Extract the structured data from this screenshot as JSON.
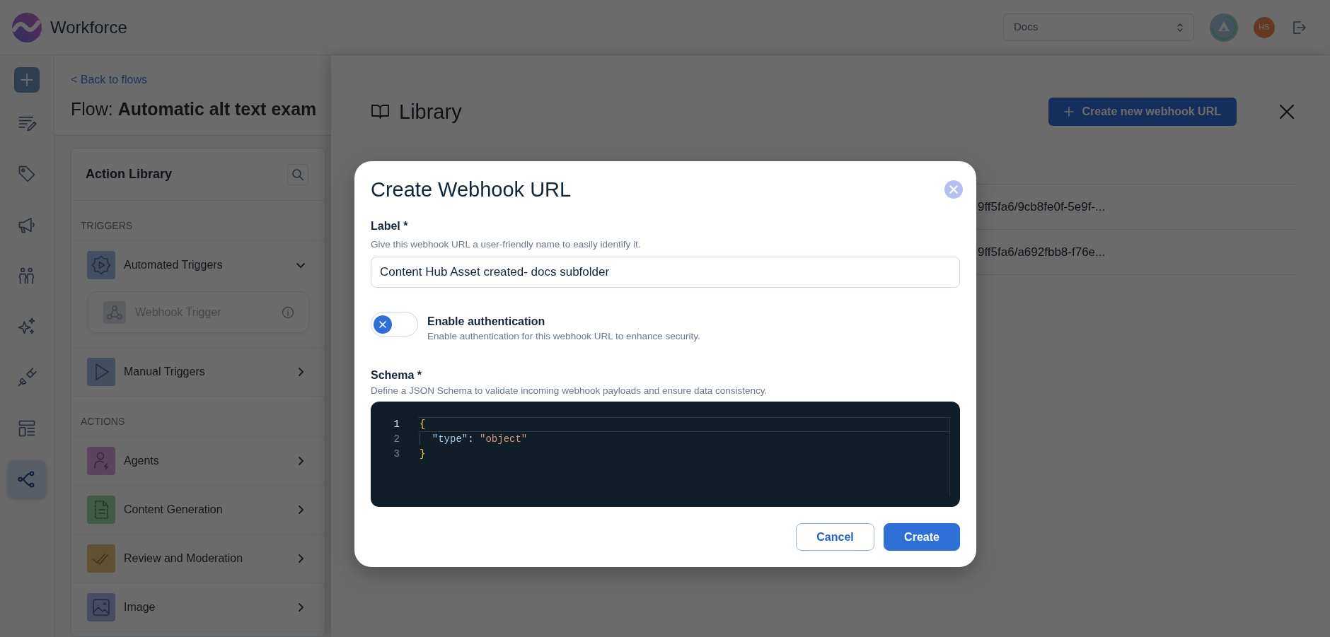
{
  "app": {
    "name": "Workforce"
  },
  "header": {
    "workspace_select": {
      "value": "Docs"
    },
    "user_avatar": {
      "initials": "HS"
    }
  },
  "nav_rail": {
    "items": [
      {
        "selected": false
      },
      {
        "selected": false
      },
      {
        "selected": false
      },
      {
        "selected": false
      },
      {
        "selected": false
      },
      {
        "selected": false
      },
      {
        "selected": false
      },
      {
        "selected": true
      }
    ]
  },
  "flow": {
    "back_link": "< Back to flows",
    "title": "Flow: **Automatic alt text exam**"
  },
  "action_library": {
    "title": "Action Library",
    "sections": [
      {
        "heading": "TRIGGERS",
        "items": [
          {
            "label": "Automated Triggers",
            "expanded": true,
            "children": [
              {
                "label": "Webhook Trigger",
                "disabled": true
              }
            ]
          },
          {
            "label": "Manual Triggers",
            "expanded": false
          }
        ]
      },
      {
        "heading": "ACTIONS",
        "items": [
          {
            "label": "Agents",
            "expanded": false
          },
          {
            "label": "Content Generation",
            "expanded": false
          },
          {
            "label": "Review and Moderation",
            "expanded": false
          },
          {
            "label": "Image",
            "expanded": false
          }
        ]
      }
    ]
  },
  "library": {
    "title": "Library",
    "create_button": "Create new webhook URL",
    "rows": [
      {
        "column_2": "9ff5fa6/9cb8fe0f-5e9f-..."
      },
      {
        "column_2": "9ff5fa6/a692fbb8-f76e..."
      }
    ]
  },
  "modal": {
    "title": "Create Webhook URL",
    "label_field": {
      "label": "Label *",
      "hint": "Give this webhook URL a user-friendly name to easily identify it.",
      "value": "Content Hub Asset created- docs subfolder"
    },
    "auth_toggle": {
      "on": false,
      "label": "Enable authentication",
      "hint": "Enable authentication for this webhook URL to enhance security."
    },
    "schema": {
      "label": "Schema *",
      "hint": "Define a JSON Schema to validate incoming webhook payloads and ensure data consistency.",
      "lines": [
        {
          "number": "1",
          "text": "{",
          "active": true
        },
        {
          "number": "2",
          "text": "  \"type\": \"object\"",
          "active": false
        },
        {
          "number": "3",
          "text": "}",
          "active": false
        }
      ]
    },
    "buttons": [
      {
        "label": "Cancel",
        "kind": "secondary"
      },
      {
        "label": "Create",
        "kind": "primary"
      }
    ]
  }
}
